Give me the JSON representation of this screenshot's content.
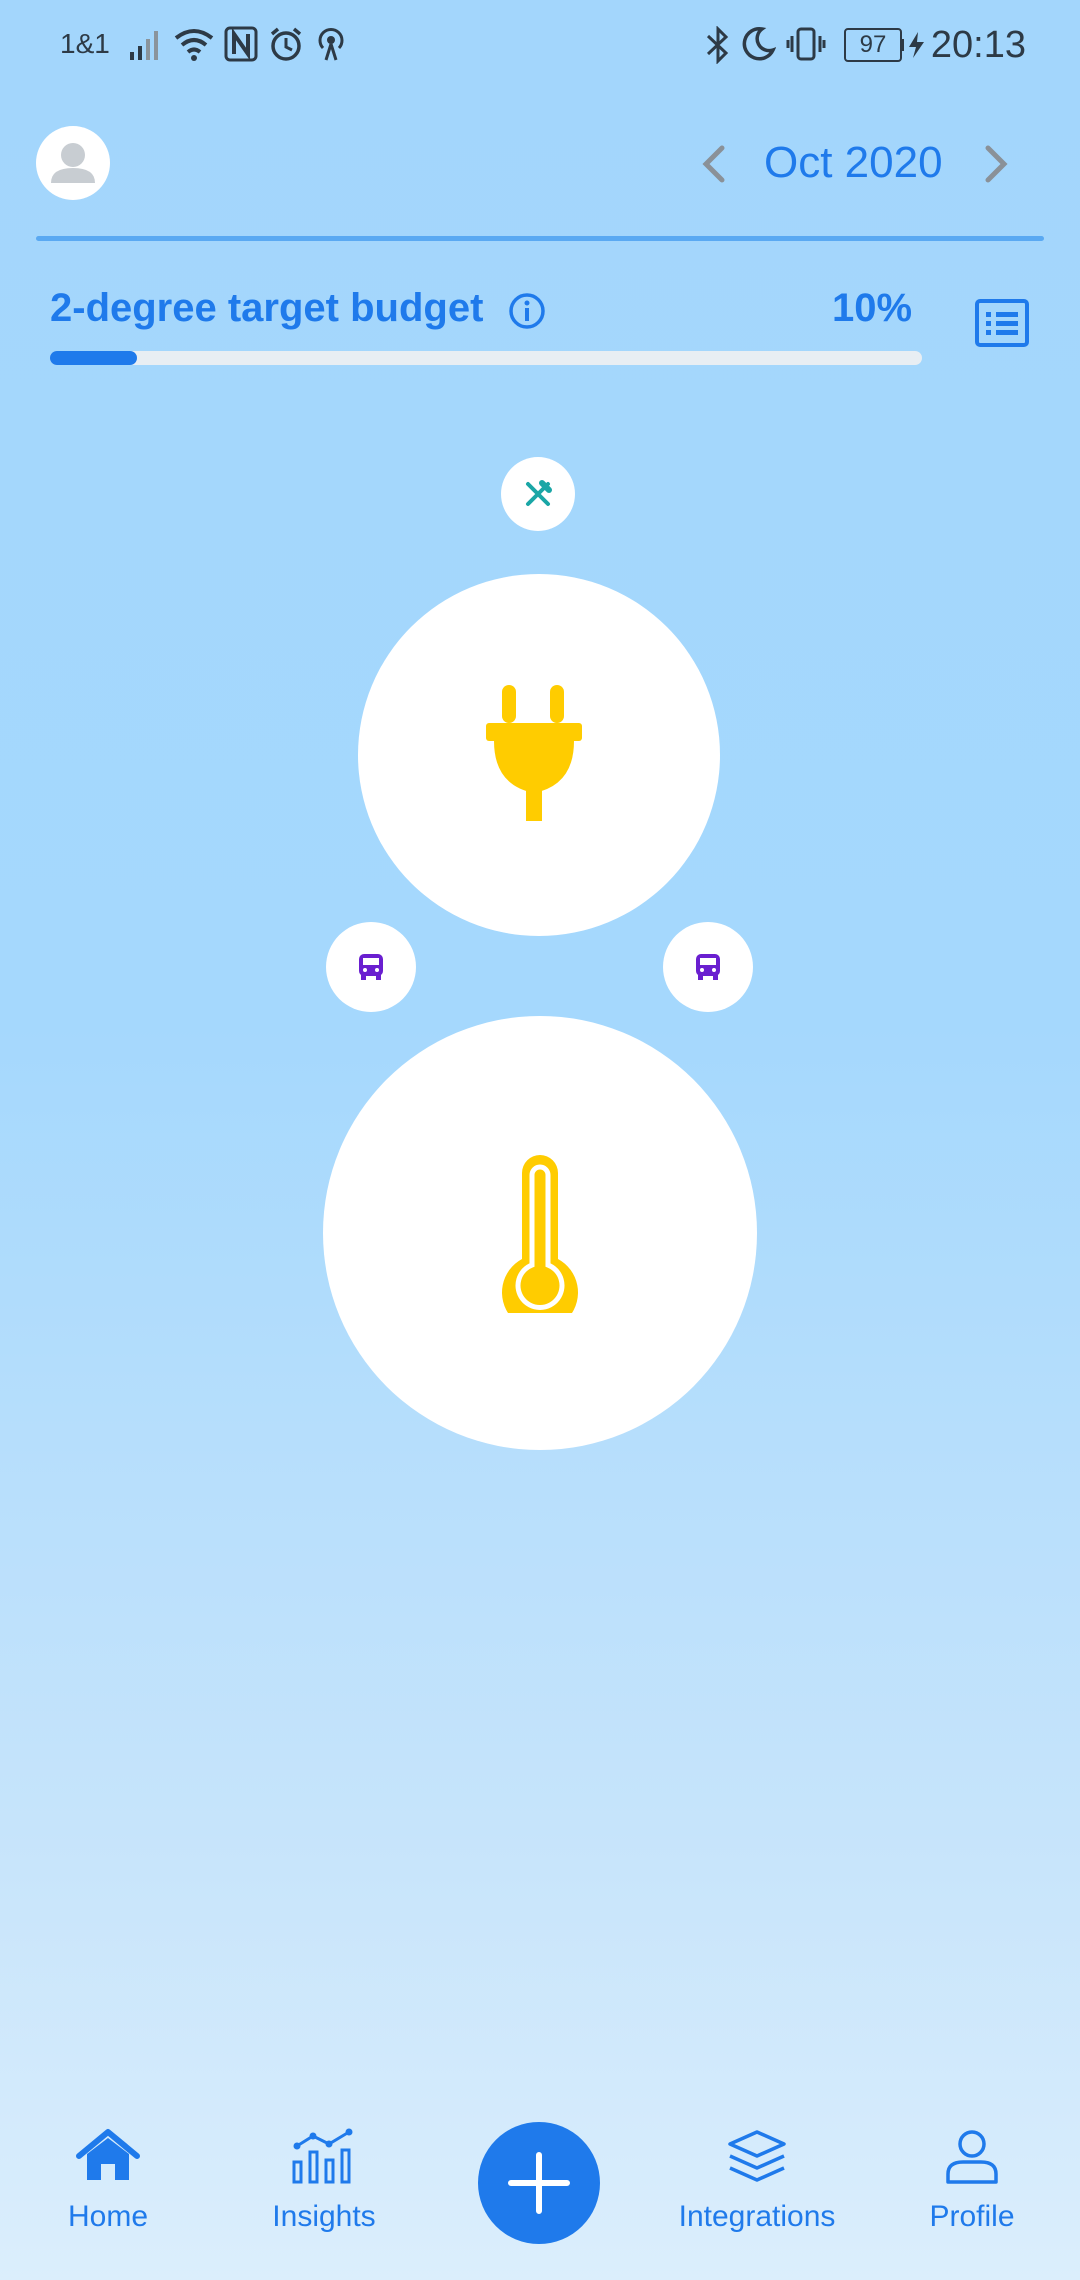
{
  "status_bar": {
    "carrier": "1&1",
    "battery": "97",
    "time": "20:13"
  },
  "header": {
    "month": "Oct 2020"
  },
  "budget": {
    "title": "2-degree target budget",
    "percent_label": "10%",
    "progress": 0.1
  },
  "categories": [
    {
      "name": "food-icon",
      "color": "#1aa6a6"
    },
    {
      "name": "plug-icon",
      "color": "#ffcc00"
    },
    {
      "name": "bus-icon",
      "color": "#6a1fd0"
    },
    {
      "name": "bus-icon",
      "color": "#6a1fd0"
    },
    {
      "name": "thermometer-icon",
      "color": "#ffcc00"
    }
  ],
  "nav": {
    "home": "Home",
    "insights": "Insights",
    "integrations": "Integrations",
    "profile": "Profile"
  },
  "colors": {
    "accent": "#1f7aeb",
    "energy": "#ffcc00",
    "transport": "#6a1fd0",
    "food": "#1aa6a6"
  }
}
